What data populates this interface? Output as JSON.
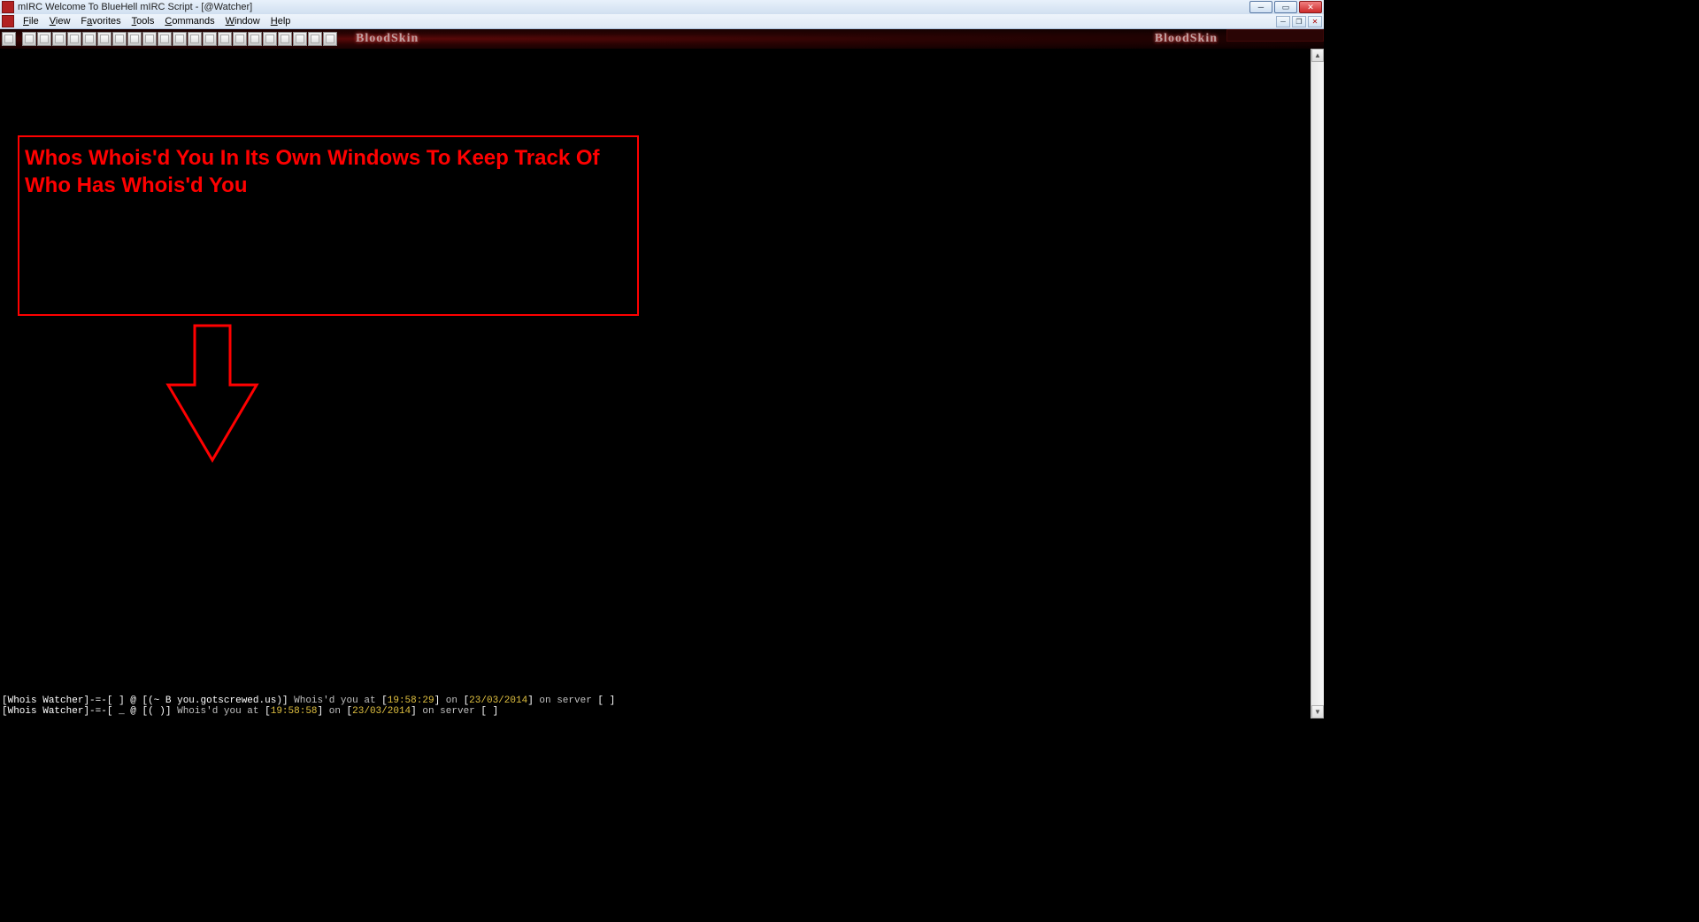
{
  "titlebar": {
    "title": "mIRC Welcome To BlueHell mIRC Script - [@Watcher]"
  },
  "menu": {
    "file": "File",
    "view": "View",
    "favorites": "Favorites",
    "tools": "Tools",
    "commands": "Commands",
    "window": "Window",
    "help": "Help"
  },
  "brand": {
    "left": "BloodSkin",
    "right": "BloodSkin"
  },
  "annotation": {
    "text": "Whos Whois'd You In Its Own Windows To Keep Track Of Who Has Whois'd You"
  },
  "log": {
    "line1": {
      "prefix": "[",
      "tag": "Whois Watcher",
      "sep1": "]-=-[",
      "nick": "     ",
      "sep2": "] @ [(~     B",
      "host_pad": "                            ",
      "host": "you.gotscrewed.us",
      "sep3": ")] ",
      "msg1": "Whois'd you at",
      "t_open": " [",
      "time": "19:58:29",
      "t_close": "] ",
      "on": "on",
      "d_open": " [",
      "date": "23/03/2014",
      "d_close": "] ",
      "srv": "on server",
      "s_open": " [",
      "server_pad": "                                     ",
      "s_close": "]"
    },
    "line2": {
      "prefix": "[",
      "tag": "Whois Watcher",
      "sep1": "]-=-[",
      "nick": "     ",
      "sep2": "_ @ [(",
      "host_pad": "                  ",
      "sep3": ")] ",
      "msg1": "Whois'd you at",
      "t_open": " [",
      "time": "19:58:58",
      "t_close": "] ",
      "on": "on",
      "d_open": " [",
      "date": "23/03/2014",
      "d_close": "] ",
      "srv": "on server",
      "s_open": " [",
      "server_pad": "                                     ",
      "s_close": "]"
    }
  }
}
